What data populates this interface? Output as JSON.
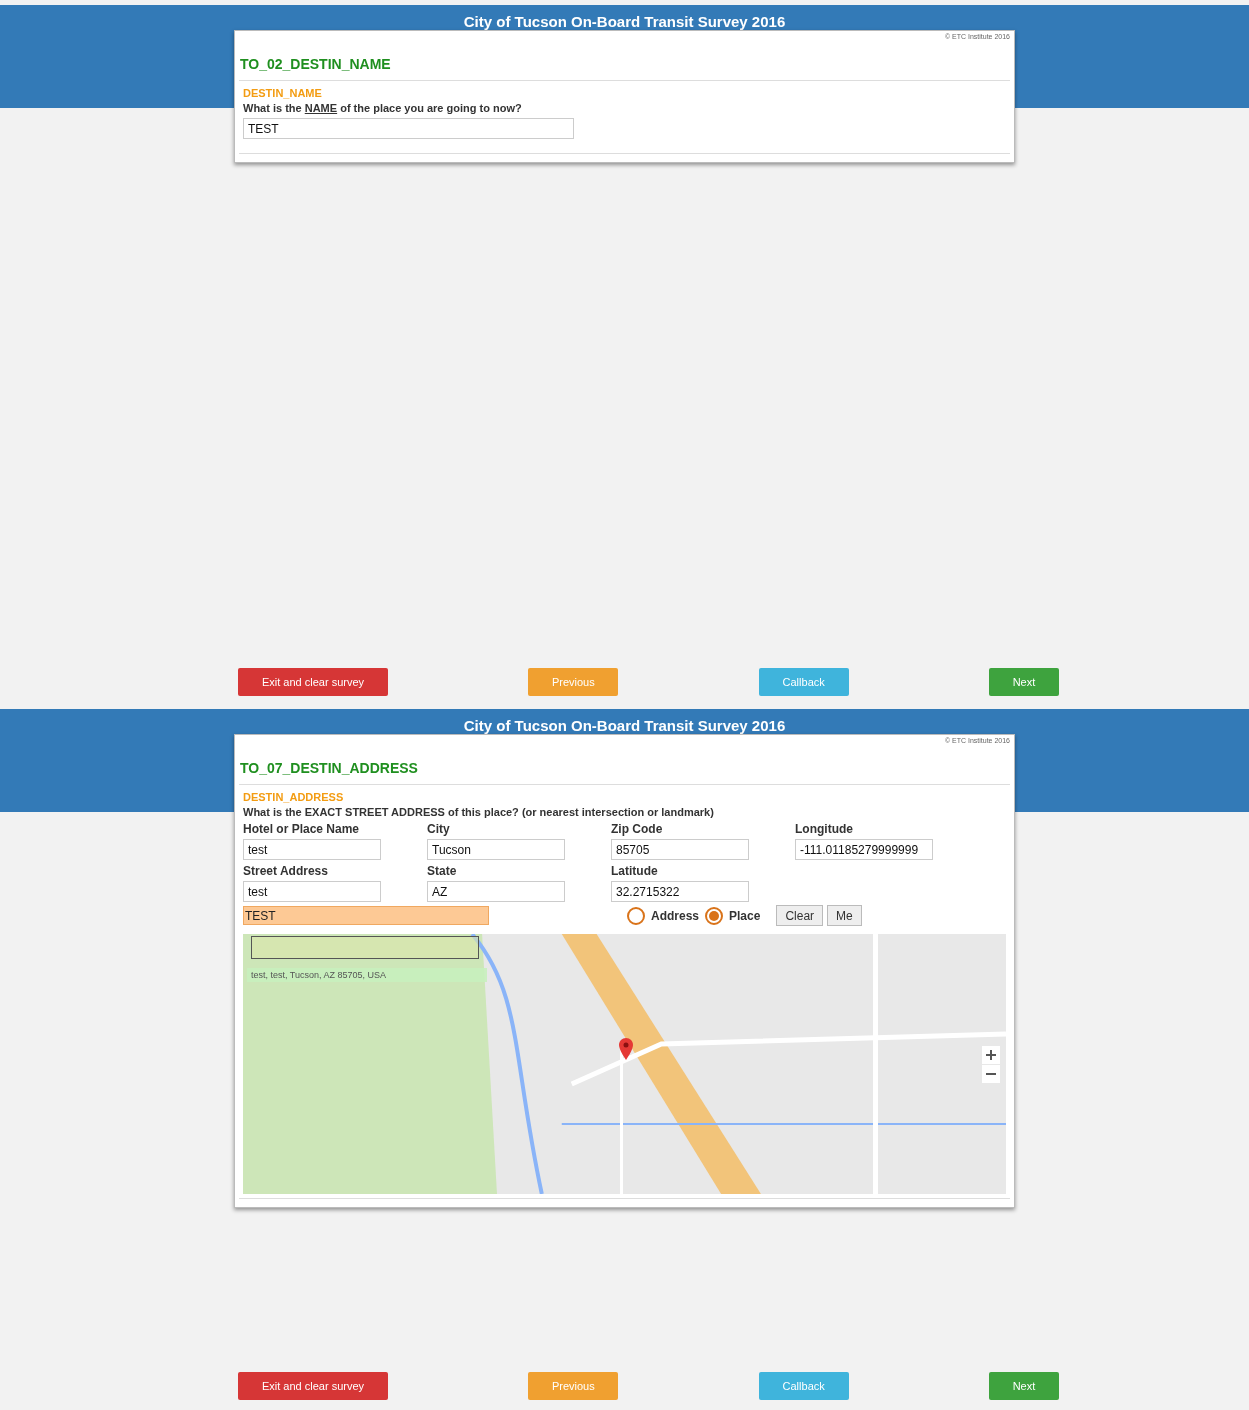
{
  "screens": [
    {
      "kind": "name",
      "header_title": "City of Tucson On-Board Transit Survey 2016",
      "copyright": "© ETC Institute 2016",
      "question_id": "TO_02_DESTIN_NAME",
      "variable": "DESTIN_NAME",
      "question": [
        {
          "text": "What is the ",
          "underlined": false
        },
        {
          "text": "NAME",
          "underlined": true
        },
        {
          "text": " of the place you are going to now?",
          "underlined": false
        }
      ],
      "answer": "TEST",
      "nav_buttons": [
        {
          "label": "Exit and clear survey",
          "kind": "exit"
        },
        {
          "label": "Previous",
          "kind": "previous"
        },
        {
          "label": "Callback",
          "kind": "callback"
        },
        {
          "label": "Next",
          "kind": "next"
        }
      ]
    },
    {
      "kind": "address",
      "header_title": "City of Tucson On-Board Transit Survey 2016",
      "copyright": "© ETC Institute 2016",
      "question_id": "TO_07_DESTIN_ADDRESS",
      "variable": "DESTIN_ADDRESS",
      "question": [
        {
          "text": "What is the EXACT STREET ADDRESS of this place? (or nearest intersection or landmark)",
          "underlined": false
        }
      ],
      "fields": [
        {
          "label": "Hotel or Place Name",
          "value": "test"
        },
        {
          "label": "City",
          "value": "Tucson"
        },
        {
          "label": "Zip Code",
          "value": "85705"
        },
        {
          "label": "Longitude",
          "value": "-111.01185279999999"
        },
        {
          "label": "Street Address",
          "value": "test"
        },
        {
          "label": "State",
          "value": "AZ"
        },
        {
          "label": "Latitude",
          "value": "32.2715322"
        }
      ],
      "search_result": "TEST",
      "radios": [
        {
          "label": "Address",
          "selected": false
        },
        {
          "label": "Place",
          "selected": true
        }
      ],
      "buttons": [
        "Clear",
        "Me"
      ],
      "map": {
        "address_label": "test, test, Tucson, AZ 85705, USA"
      },
      "nav_buttons": [
        {
          "label": "Exit and clear survey",
          "kind": "exit"
        },
        {
          "label": "Previous",
          "kind": "previous"
        },
        {
          "label": "Callback",
          "kind": "callback"
        },
        {
          "label": "Next",
          "kind": "next"
        }
      ]
    }
  ]
}
